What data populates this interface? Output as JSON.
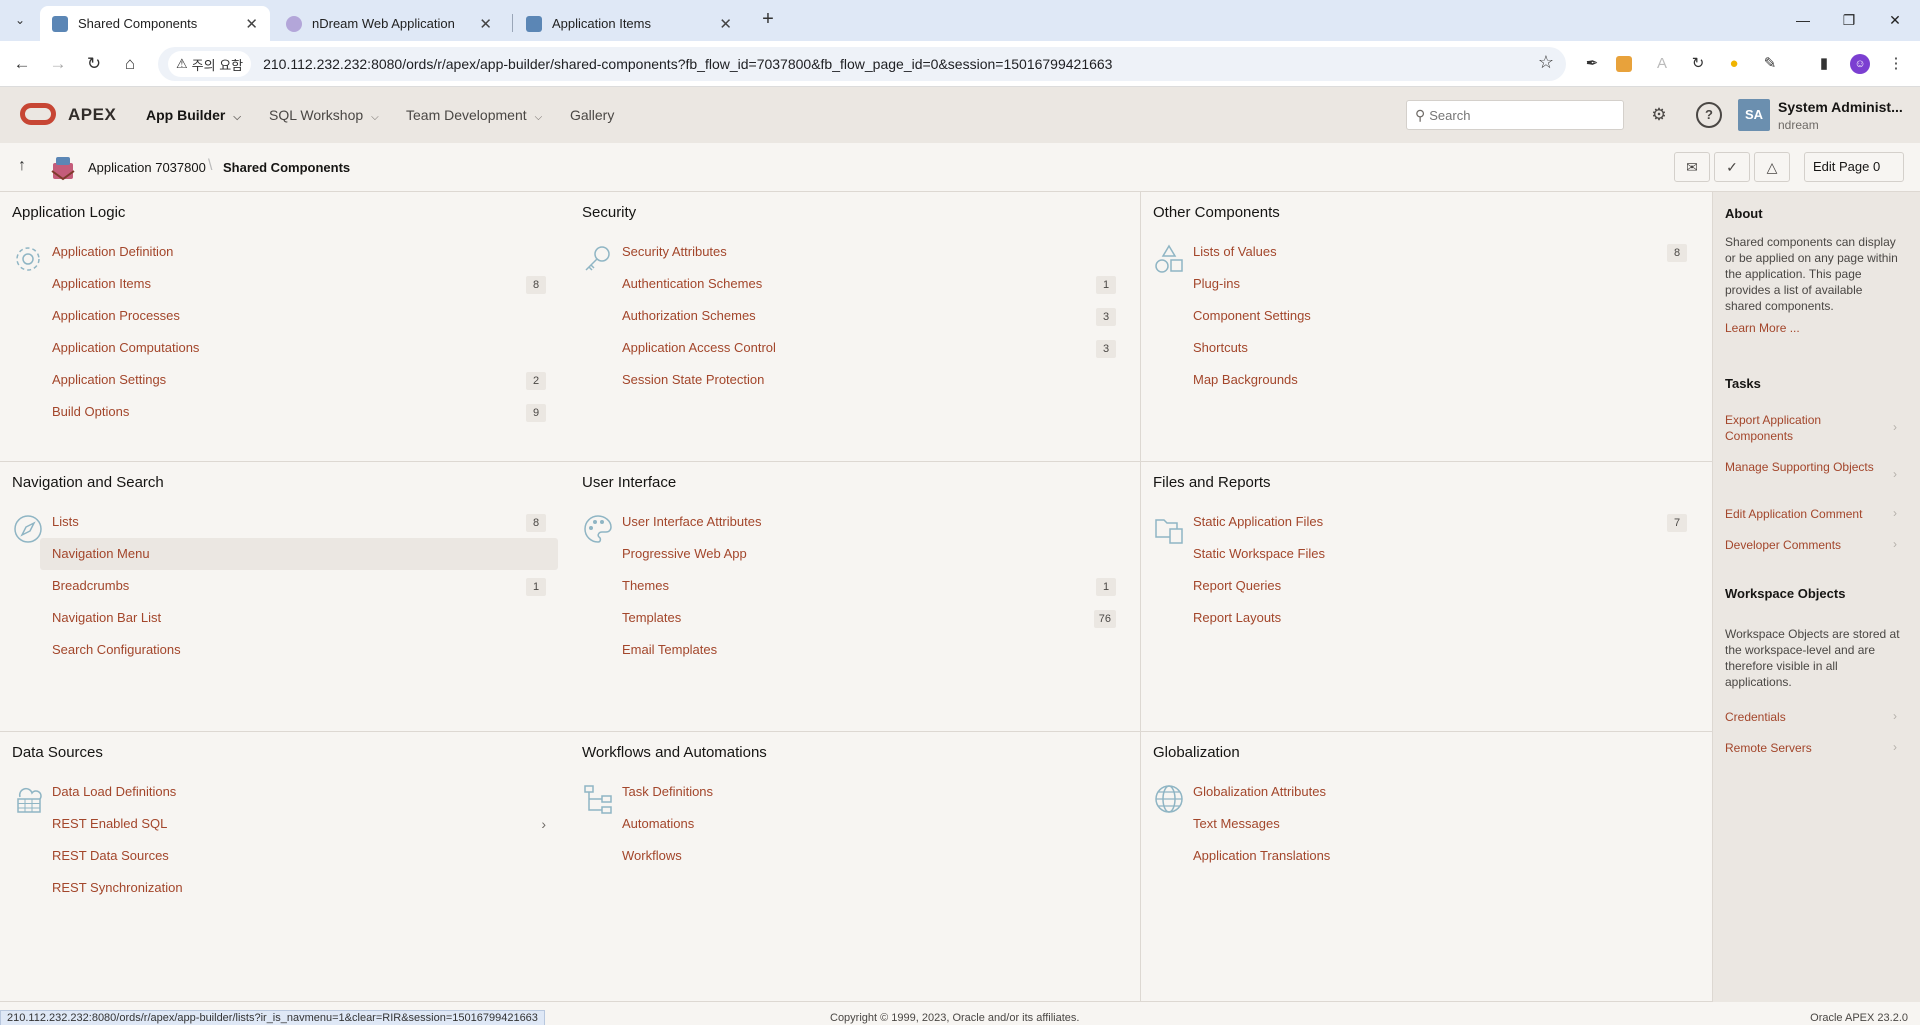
{
  "browser": {
    "tabs": [
      {
        "title": "Shared Components",
        "active": true
      },
      {
        "title": "nDream Web Application",
        "active": false
      },
      {
        "title": "Application Items",
        "active": false
      }
    ],
    "security_chip": "주의 요함",
    "url": "210.112.232.232:8080/ords/r/apex/app-builder/shared-components?fb_flow_id=7037800&fb_flow_page_id=0&session=15016799421663"
  },
  "header": {
    "logo_text": "APEX",
    "menus": [
      {
        "label": "App Builder",
        "active": true
      },
      {
        "label": "SQL Workshop",
        "active": false
      },
      {
        "label": "Team Development",
        "active": false
      },
      {
        "label": "Gallery",
        "active": false
      }
    ],
    "search_placeholder": "Search",
    "avatar_initials": "SA",
    "user_name": "System Administ...",
    "workspace": "ndream"
  },
  "breadcrumb": {
    "application": "Application 7037800",
    "current": "Shared Components",
    "edit_page_label": "Edit Page 0"
  },
  "regions": [
    {
      "title": "Application Logic",
      "icon": "gear-icon",
      "items": [
        {
          "label": "Application Definition",
          "count": ""
        },
        {
          "label": "Application Items",
          "count": "8"
        },
        {
          "label": "Application Processes",
          "count": ""
        },
        {
          "label": "Application Computations",
          "count": ""
        },
        {
          "label": "Application Settings",
          "count": "2"
        },
        {
          "label": "Build Options",
          "count": "9"
        }
      ]
    },
    {
      "title": "Security",
      "icon": "key-icon",
      "items": [
        {
          "label": "Security Attributes",
          "count": ""
        },
        {
          "label": "Authentication Schemes",
          "count": "1"
        },
        {
          "label": "Authorization Schemes",
          "count": "3"
        },
        {
          "label": "Application Access Control",
          "count": "3"
        },
        {
          "label": "Session State Protection",
          "count": ""
        }
      ]
    },
    {
      "title": "Other Components",
      "icon": "shapes-icon",
      "items": [
        {
          "label": "Lists of Values",
          "count": "8"
        },
        {
          "label": "Plug-ins",
          "count": ""
        },
        {
          "label": "Component Settings",
          "count": ""
        },
        {
          "label": "Shortcuts",
          "count": ""
        },
        {
          "label": "Map Backgrounds",
          "count": ""
        }
      ]
    },
    {
      "title": "Navigation and Search",
      "icon": "compass-icon",
      "items": [
        {
          "label": "Lists",
          "count": "8"
        },
        {
          "label": "Navigation Menu",
          "count": "",
          "highlighted": true
        },
        {
          "label": "Breadcrumbs",
          "count": "1"
        },
        {
          "label": "Navigation Bar List",
          "count": ""
        },
        {
          "label": "Search Configurations",
          "count": ""
        }
      ]
    },
    {
      "title": "User Interface",
      "icon": "palette-icon",
      "items": [
        {
          "label": "User Interface Attributes",
          "count": ""
        },
        {
          "label": "Progressive Web App",
          "count": ""
        },
        {
          "label": "Themes",
          "count": "1"
        },
        {
          "label": "Templates",
          "count": "76"
        },
        {
          "label": "Email Templates",
          "count": ""
        }
      ]
    },
    {
      "title": "Files and Reports",
      "icon": "folder-file-icon",
      "items": [
        {
          "label": "Static Application Files",
          "count": "7"
        },
        {
          "label": "Static Workspace Files",
          "count": ""
        },
        {
          "label": "Report Queries",
          "count": ""
        },
        {
          "label": "Report Layouts",
          "count": ""
        }
      ]
    },
    {
      "title": "Data Sources",
      "icon": "cloud-grid-icon",
      "items": [
        {
          "label": "Data Load Definitions",
          "count": ""
        },
        {
          "label": "REST Enabled SQL",
          "count": "",
          "chevron": true
        },
        {
          "label": "REST Data Sources",
          "count": ""
        },
        {
          "label": "REST Synchronization",
          "count": ""
        }
      ]
    },
    {
      "title": "Workflows and Automations",
      "icon": "flow-tree-icon",
      "items": [
        {
          "label": "Task Definitions",
          "count": ""
        },
        {
          "label": "Automations",
          "count": ""
        },
        {
          "label": "Workflows",
          "count": ""
        }
      ]
    },
    {
      "title": "Globalization",
      "icon": "globe-icon",
      "items": [
        {
          "label": "Globalization Attributes",
          "count": ""
        },
        {
          "label": "Text Messages",
          "count": ""
        },
        {
          "label": "Application Translations",
          "count": ""
        }
      ]
    }
  ],
  "sidebar": {
    "about_title": "About",
    "about_text": "Shared components can display or be applied on any page within the application. This page provides a list of available shared components.",
    "learn_more": "Learn More ...",
    "tasks_title": "Tasks",
    "tasks": [
      "Export Application Components",
      "Manage Supporting Objects",
      "Edit Application Comment",
      "Developer Comments"
    ],
    "workspace_title": "Workspace Objects",
    "workspace_text": "Workspace Objects are stored at the workspace-level and are therefore visible in all applications.",
    "workspace_links": [
      "Credentials",
      "Remote Servers"
    ]
  },
  "footer": {
    "status_url": "210.112.232.232:8080/ords/r/apex/app-builder/lists?ir_is_navmenu=1&clear=RIR&session=15016799421663",
    "copyright": "Copyright © 1999, 2023, Oracle and/or its affiliates.",
    "version": "Oracle APEX 23.2.0"
  },
  "colors": {
    "accent": "#c74634",
    "link": "#a3462b",
    "header_bg": "#ebe7e2",
    "page_bg": "#f7f5f2"
  }
}
